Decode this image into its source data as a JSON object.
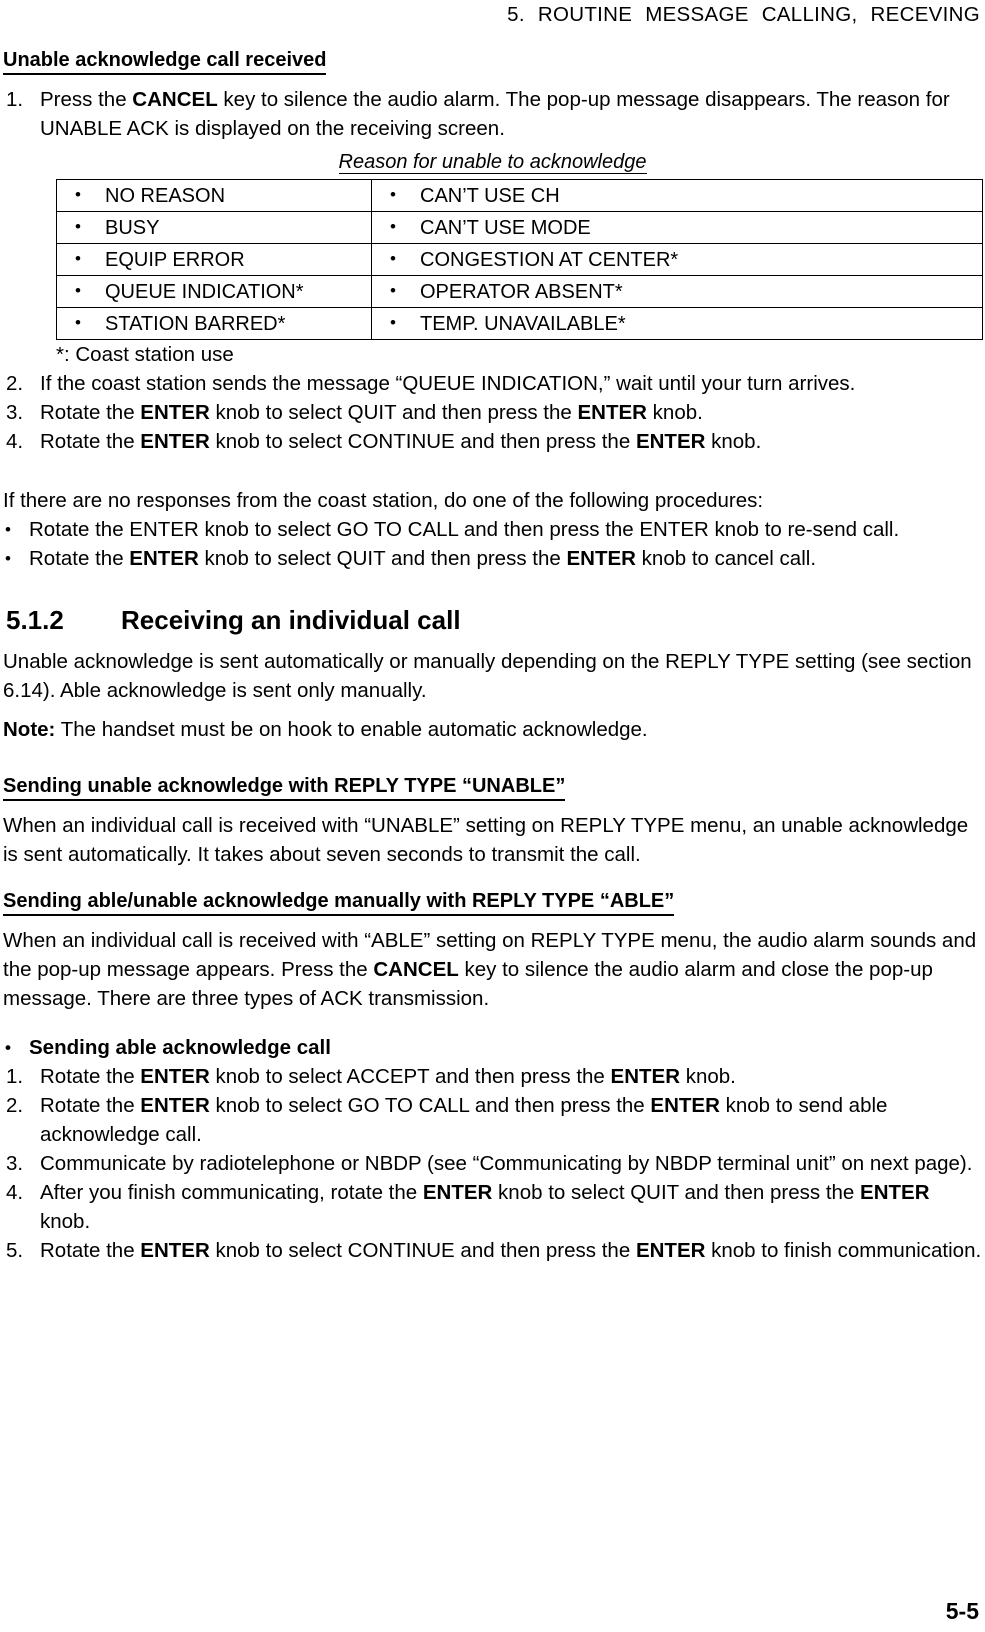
{
  "header": {
    "running_title": "5. ROUTINE  MESSAGE  CALLING,  RECEVING"
  },
  "page_number": "5-5",
  "sections": {
    "unable_ack": {
      "heading": "Unable acknowledge call received",
      "steps": [
        {
          "marker": "1.",
          "text_parts": [
            {
              "t": "Press the ",
              "b": false
            },
            {
              "t": "CANCEL",
              "b": true
            },
            {
              "t": " key to silence the audio alarm. The pop-up message disappears. The reason for UNABLE ACK is displayed on the receiving screen.",
              "b": false
            }
          ]
        },
        {
          "marker": "2.",
          "text_parts": [
            {
              "t": "If the coast station sends the message “QUEUE INDICATION,” wait until your turn arrives.",
              "b": false
            }
          ]
        },
        {
          "marker": "3.",
          "text_parts": [
            {
              "t": "Rotate the ",
              "b": false
            },
            {
              "t": "ENTER",
              "b": true
            },
            {
              "t": " knob to select QUIT and then press the ",
              "b": false
            },
            {
              "t": "ENTER",
              "b": true
            },
            {
              "t": " knob.",
              "b": false
            }
          ]
        },
        {
          "marker": "4.",
          "text_parts": [
            {
              "t": "Rotate the ",
              "b": false
            },
            {
              "t": "ENTER",
              "b": true
            },
            {
              "t": " knob to select CONTINUE and then press the ",
              "b": false
            },
            {
              "t": "ENTER",
              "b": true
            },
            {
              "t": " knob.",
              "b": false
            }
          ]
        }
      ],
      "table_caption": "Reason for unable to acknowledge",
      "table_rows": [
        {
          "left": "NO REASON",
          "right": "CAN’T USE CH"
        },
        {
          "left": "BUSY",
          "right": "CAN’T USE MODE"
        },
        {
          "left": "EQUIP ERROR",
          "right": "CONGESTION AT CENTER*"
        },
        {
          "left": "QUEUE INDICATION*",
          "right": "OPERATOR ABSENT*"
        },
        {
          "left": "STATION BARRED*",
          "right": "TEMP. UNAVAILABLE*"
        }
      ],
      "table_footnote": "*: Coast station use",
      "bullet_marker": "•",
      "no_response_intro": "If there are no responses from the coast station, do one of the following procedures:",
      "no_response_bullets": [
        {
          "text_parts": [
            {
              "t": "Rotate the ENTER knob to select GO TO CALL and then press the ENTER knob to re-send call.",
              "b": false
            }
          ]
        },
        {
          "text_parts": [
            {
              "t": "Rotate the ",
              "b": false
            },
            {
              "t": "ENTER",
              "b": true
            },
            {
              "t": " knob to select QUIT and then press the ",
              "b": false
            },
            {
              "t": "ENTER",
              "b": true
            },
            {
              "t": " knob to cancel call.",
              "b": false
            }
          ]
        }
      ]
    },
    "receiving_individual": {
      "number": "5.1.2",
      "title": "Receiving an individual call",
      "intro": "Unable acknowledge is sent automatically or manually depending on the REPLY TYPE setting (see section 6.14). Able acknowledge is sent only manually.",
      "note_label": "Note:",
      "note_text": " The handset must be on hook to enable automatic acknowledge.",
      "sub1": {
        "heading": "Sending unable acknowledge with REPLY TYPE “UNABLE”",
        "body": "When an individual call is received with “UNABLE” setting on REPLY TYPE menu, an unable acknowledge is sent automatically. It takes about seven seconds to transmit the call."
      },
      "sub2": {
        "heading": "Sending able/unable acknowledge manually with REPLY TYPE “ABLE”",
        "body_parts": [
          {
            "t": "When an individual call is received with “ABLE” setting on REPLY TYPE menu, the audio alarm sounds and the pop-up message appears. Press the ",
            "b": false
          },
          {
            "t": "CANCEL",
            "b": true
          },
          {
            "t": " key to silence the audio alarm and close the pop-up message. There are three types of ACK transmission.",
            "b": false
          }
        ],
        "bullet_heading": "Sending able acknowledge call",
        "steps": [
          {
            "marker": "1.",
            "text_parts": [
              {
                "t": "Rotate the ",
                "b": false
              },
              {
                "t": "ENTER",
                "b": true
              },
              {
                "t": " knob to select ACCEPT and then press the ",
                "b": false
              },
              {
                "t": "ENTER",
                "b": true
              },
              {
                "t": " knob.",
                "b": false
              }
            ]
          },
          {
            "marker": "2.",
            "text_parts": [
              {
                "t": "Rotate the ",
                "b": false
              },
              {
                "t": "ENTER",
                "b": true
              },
              {
                "t": " knob to select GO TO CALL and then press the ",
                "b": false
              },
              {
                "t": "ENTER",
                "b": true
              },
              {
                "t": " knob to send able acknowledge call.",
                "b": false
              }
            ]
          },
          {
            "marker": "3.",
            "text_parts": [
              {
                "t": "Communicate by radiotelephone or NBDP (see “Communicating by NBDP terminal unit” on next page).",
                "b": false
              }
            ]
          },
          {
            "marker": "4.",
            "text_parts": [
              {
                "t": "After you finish communicating, rotate the ",
                "b": false
              },
              {
                "t": "ENTER",
                "b": true
              },
              {
                "t": " knob to select QUIT and then press the ",
                "b": false
              },
              {
                "t": "ENTER",
                "b": true
              },
              {
                "t": " knob.",
                "b": false
              }
            ]
          },
          {
            "marker": "5.",
            "text_parts": [
              {
                "t": "Rotate the ",
                "b": false
              },
              {
                "t": "ENTER",
                "b": true
              },
              {
                "t": " knob to select CONTINUE and then press the ",
                "b": false
              },
              {
                "t": "ENTER",
                "b": true
              },
              {
                "t": " knob to finish communication.",
                "b": false
              }
            ]
          }
        ]
      }
    }
  }
}
